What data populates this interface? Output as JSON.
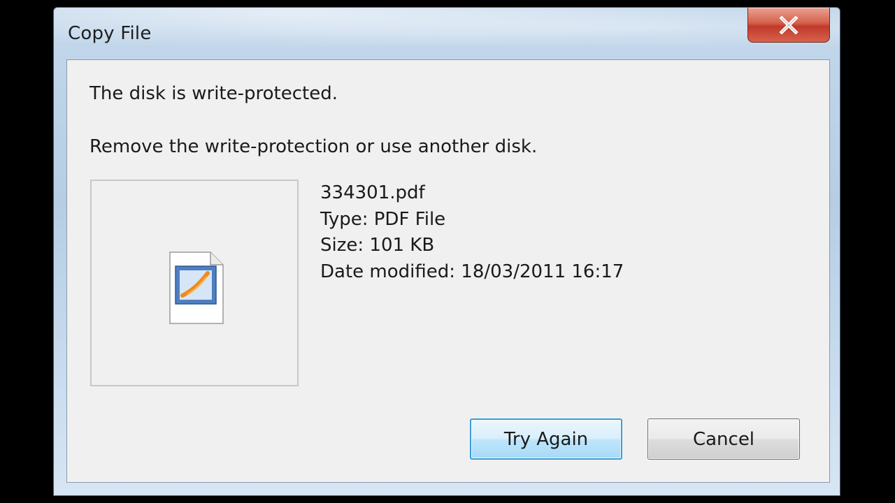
{
  "window": {
    "title": "Copy File",
    "close_icon": "close-x-icon"
  },
  "message": {
    "line1": "The disk is write-protected.",
    "line2": "Remove the write-protection or use another disk."
  },
  "file": {
    "icon": "pdf-file-icon",
    "name": "334301.pdf",
    "type": "Type: PDF File",
    "size": "Size: 101 KB",
    "date_modified": "Date modified: 18/03/2011 16:17"
  },
  "buttons": {
    "try_again": "Try Again",
    "cancel": "Cancel"
  },
  "colors": {
    "title_bar": "#b6cde4",
    "content_bg": "#f0f0f0",
    "close_button": "#c0392b",
    "default_button_border": "#3c9dd6"
  }
}
